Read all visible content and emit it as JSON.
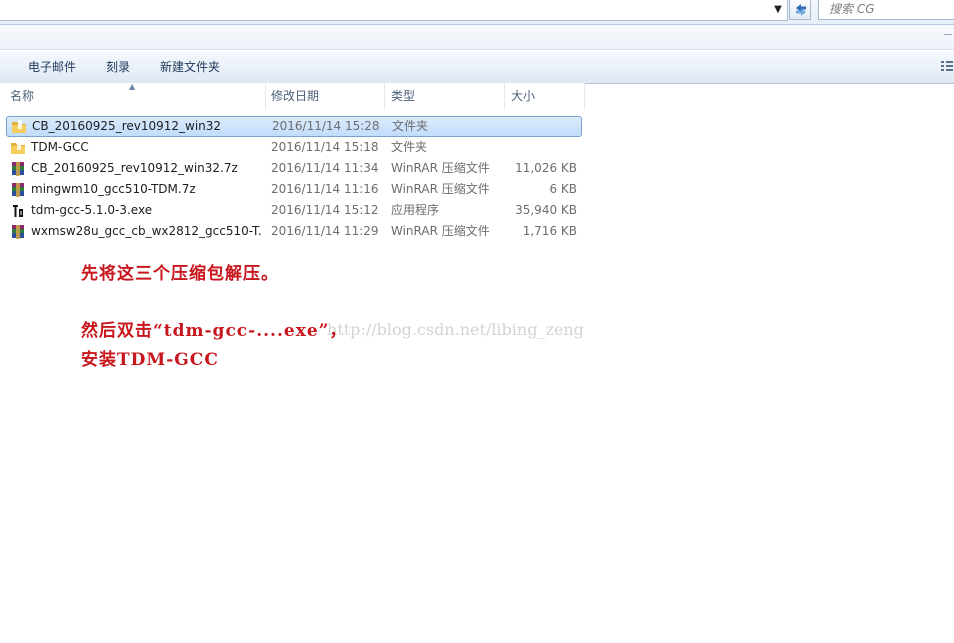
{
  "address_bar": {
    "search_placeholder": "搜索 CG"
  },
  "toolbar": {
    "buttons": [
      "电子邮件",
      "刻录",
      "新建文件夹"
    ]
  },
  "columns": [
    "名称",
    "修改日期",
    "类型",
    "大小"
  ],
  "files": [
    {
      "name": "CB_20160925_rev10912_win32",
      "date": "2016/11/14 15:28",
      "type": "文件夹",
      "size": "",
      "icon": "folder-icon",
      "selected": true
    },
    {
      "name": "TDM-GCC",
      "date": "2016/11/14 15:18",
      "type": "文件夹",
      "size": "",
      "icon": "folder-icon",
      "selected": false
    },
    {
      "name": "CB_20160925_rev10912_win32.7z",
      "date": "2016/11/14 11:34",
      "type": "WinRAR 压缩文件",
      "size": "11,026 KB",
      "icon": "winrar-archive-icon",
      "selected": false
    },
    {
      "name": "mingwm10_gcc510-TDM.7z",
      "date": "2016/11/14 11:16",
      "type": "WinRAR 压缩文件",
      "size": "6 KB",
      "icon": "winrar-archive-icon",
      "selected": false
    },
    {
      "name": "tdm-gcc-5.1.0-3.exe",
      "date": "2016/11/14 15:12",
      "type": "应用程序",
      "size": "35,940 KB",
      "icon": "tdm-installer-icon",
      "selected": false
    },
    {
      "name": "wxmsw28u_gcc_cb_wx2812_gcc510-T...",
      "date": "2016/11/14 11:29",
      "type": "WinRAR 压缩文件",
      "size": "1,716 KB",
      "icon": "winrar-archive-icon",
      "selected": false
    }
  ],
  "annotations": {
    "line1": "先将这三个压缩包解压。",
    "line2": "然后双击“tdm-gcc-....exe”，",
    "line3": "安装TDM-GCC",
    "color": "#c8161d"
  },
  "watermark": "http://blog.csdn.net/libing_zeng",
  "colors": {
    "selection_fill": "#c1dcfc",
    "selection_border": "#7da2ce",
    "toolbar_text": "#1e395b"
  }
}
